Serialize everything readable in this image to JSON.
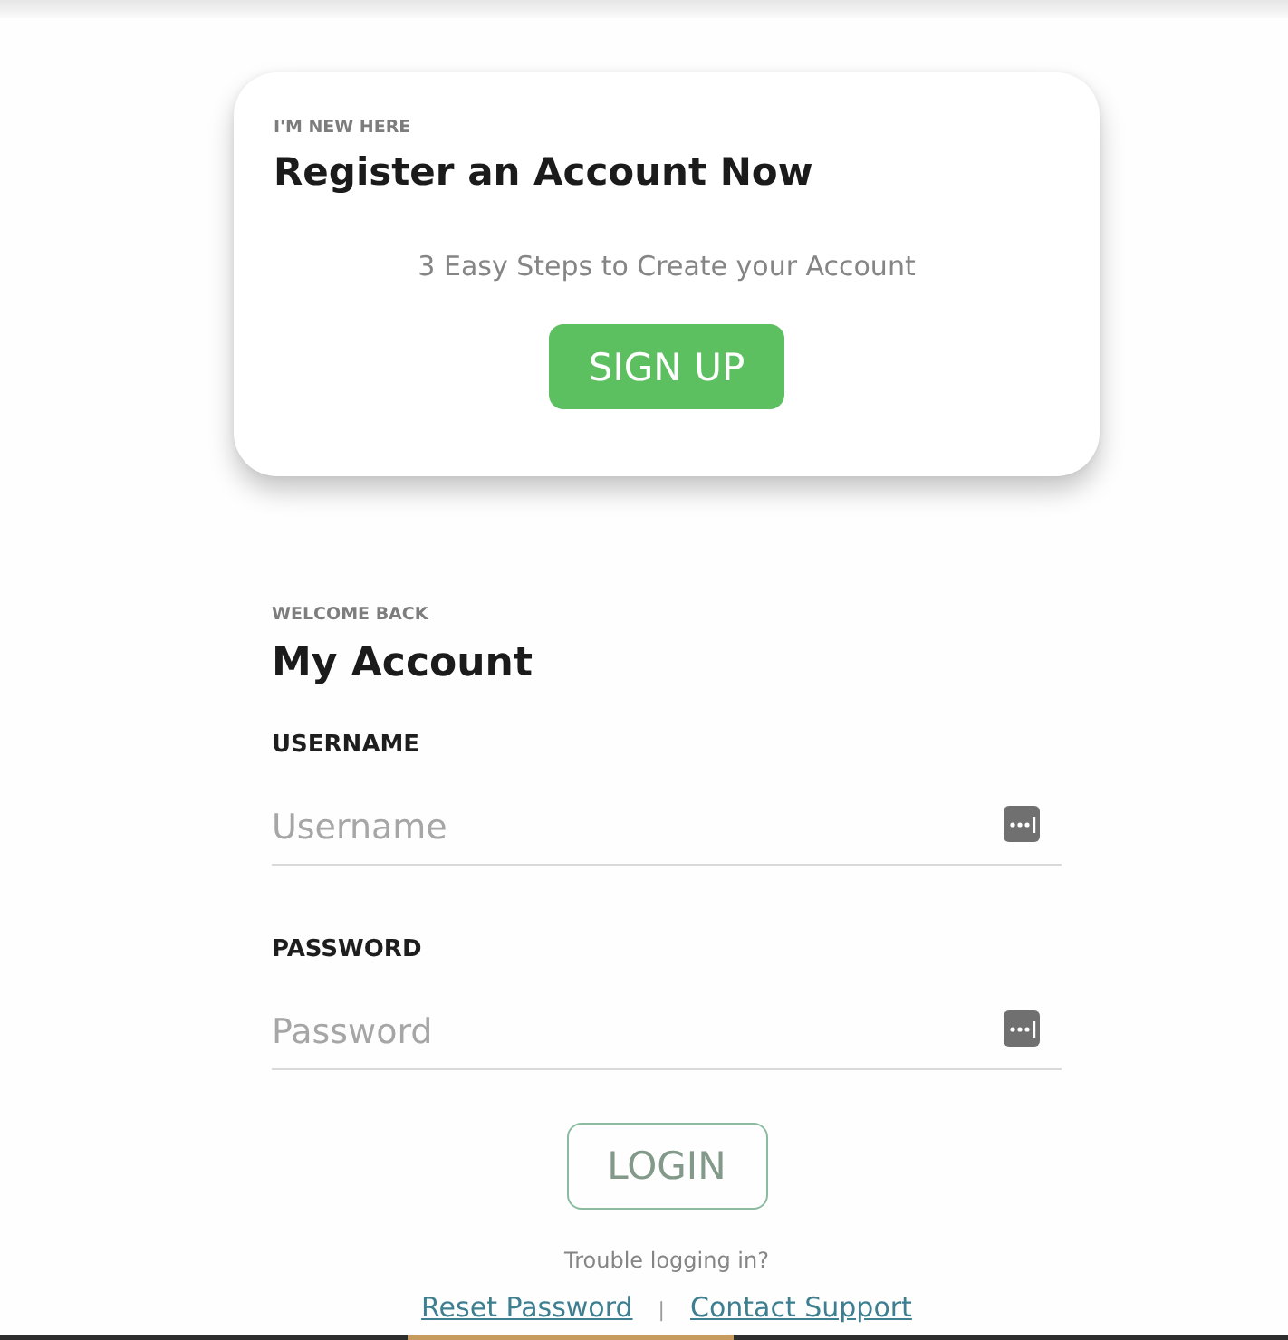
{
  "register_card": {
    "eyebrow": "I'M NEW HERE",
    "title": "Register an Account Now",
    "subtitle": "3 Easy Steps to Create your Account",
    "button": "SIGN UP"
  },
  "login": {
    "eyebrow": "WELCOME BACK",
    "title": "My Account",
    "fields": [
      {
        "label": "USERNAME",
        "placeholder": "Username"
      },
      {
        "label": "PASSWORD",
        "placeholder": "Password"
      }
    ],
    "button": "LOGIN",
    "help_text": "Trouble logging in?",
    "links": [
      "Reset Password",
      "Contact Support"
    ],
    "separator": "|"
  }
}
